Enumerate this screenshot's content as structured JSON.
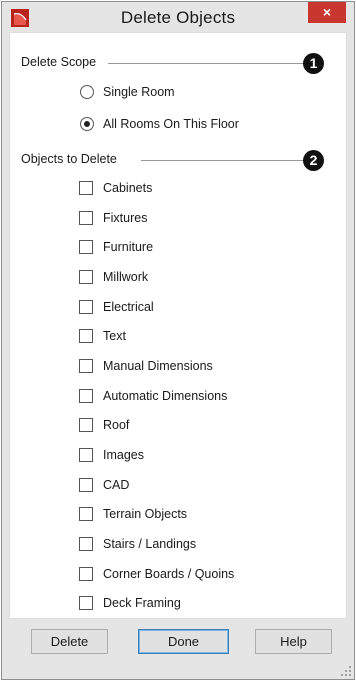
{
  "window": {
    "title": "Delete Objects",
    "close_symbol": "×",
    "app_icon": "chief-architect-logo-icon",
    "accent_color": "#c7372f"
  },
  "scope": {
    "label": "Delete Scope",
    "callout": "1",
    "options": [
      {
        "label": "Single Room",
        "selected": false
      },
      {
        "label": "All Rooms On This Floor",
        "selected": true
      }
    ]
  },
  "objects": {
    "label": "Objects to Delete",
    "callout": "2",
    "items": [
      {
        "label": "Cabinets",
        "checked": false
      },
      {
        "label": "Fixtures",
        "checked": false
      },
      {
        "label": "Furniture",
        "checked": false
      },
      {
        "label": "Millwork",
        "checked": false
      },
      {
        "label": "Electrical",
        "checked": false
      },
      {
        "label": "Text",
        "checked": false
      },
      {
        "label": "Manual Dimensions",
        "checked": false
      },
      {
        "label": "Automatic Dimensions",
        "checked": false
      },
      {
        "label": "Roof",
        "checked": false
      },
      {
        "label": "Images",
        "checked": false
      },
      {
        "label": "CAD",
        "checked": false
      },
      {
        "label": "Terrain Objects",
        "checked": false
      },
      {
        "label": "Stairs / Landings",
        "checked": false
      },
      {
        "label": "Corner Boards / Quoins",
        "checked": false
      },
      {
        "label": "Deck Framing",
        "checked": false
      }
    ]
  },
  "buttons": {
    "delete": "Delete",
    "done": "Done",
    "help": "Help"
  }
}
